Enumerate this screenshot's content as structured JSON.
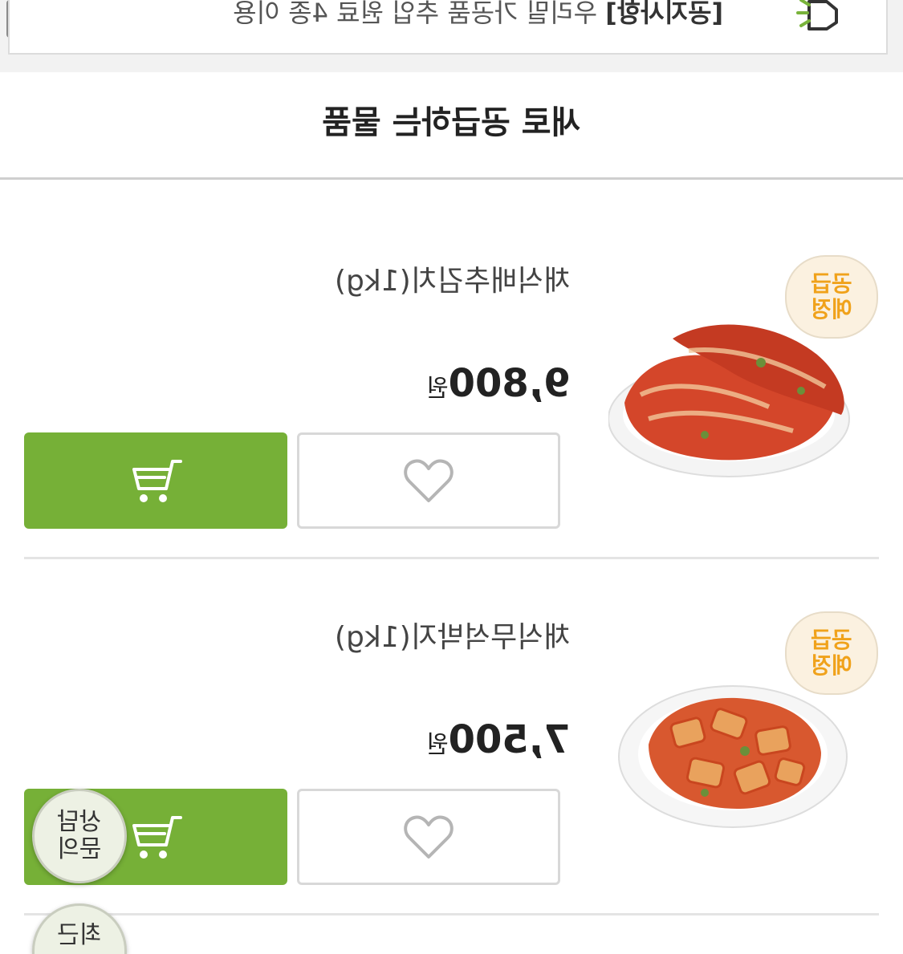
{
  "notice": {
    "tag": "[공지사항]",
    "text": " 우리밀 가공품 추입 원료 4종 이용",
    "icon": "megaphone-icon"
  },
  "section": {
    "title": "새로 공급하는 물품"
  },
  "products": [
    {
      "badge_line1": "공급",
      "badge_line2": "예정",
      "name": "채식배추김치(1kg)",
      "price": "9,800",
      "unit": "원",
      "image": "cabbage-kimchi-image"
    },
    {
      "badge_line1": "공급",
      "badge_line2": "예정",
      "name": "채식무석박지(1kg)",
      "price": "7,500",
      "unit": "원",
      "image": "radish-kimchi-image"
    }
  ],
  "floating": {
    "consult_line1": "상담",
    "consult_line2": "문의",
    "recent_line1": "최근"
  },
  "colors": {
    "accent_green": "#76b037",
    "badge_orange": "#f0a21b"
  }
}
